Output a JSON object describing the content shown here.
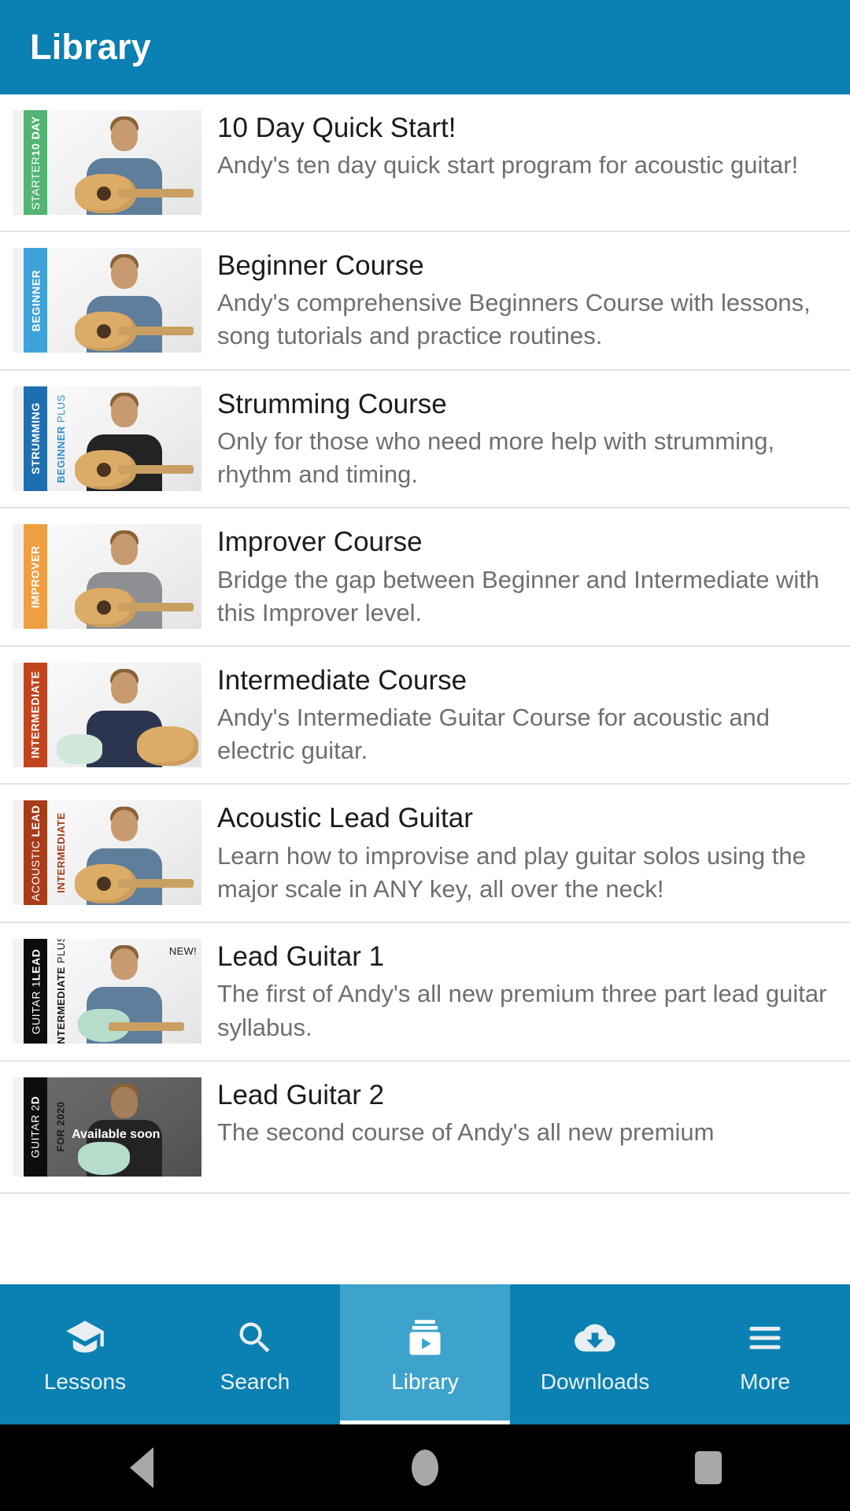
{
  "appbar": {
    "title": "Library"
  },
  "courses": [
    {
      "title": "10 Day Quick Start!",
      "description": "Andy's ten day quick start program for acoustic guitar!",
      "badge": "10 DAY STARTER",
      "badge_bold": "10 DAY",
      "badge_thin": " STARTER",
      "badge_color": "#54b473",
      "sublabel": "",
      "sublabel_color": "",
      "tag": ""
    },
    {
      "title": "Beginner Course",
      "description": "Andy's comprehensive Beginners Course with lessons, song tutorials and practice routines.",
      "badge": "BEGINNER",
      "badge_bold": "BEGINNER",
      "badge_thin": "",
      "badge_color": "#3ea3d8",
      "sublabel": "",
      "sublabel_color": "",
      "tag": ""
    },
    {
      "title": "Strumming Course",
      "description": "Only for those who need more help with strumming, rhythm and timing.",
      "badge": "STRUMMING",
      "badge_bold": "STRUMMING",
      "badge_thin": "",
      "badge_color": "#1f6fb0",
      "sublabel": "BEGINNER PLUS",
      "sublabel_bold": "BEGINNER",
      "sublabel_thin": " PLUS",
      "sublabel_color": "#2f8fd0",
      "tag": ""
    },
    {
      "title": "Improver Course",
      "description": "Bridge the gap between Beginner and Intermediate with this Improver level.",
      "badge": "IMPROVER",
      "badge_bold": "IMPROVER",
      "badge_thin": "",
      "badge_color": "#ef9f42",
      "sublabel": "",
      "sublabel_color": "",
      "tag": ""
    },
    {
      "title": "Intermediate Course",
      "description": "Andy's Intermediate Guitar Course for acoustic and electric guitar.",
      "badge": "INTERMEDIATE",
      "badge_bold": "INTERMEDIATE",
      "badge_thin": "",
      "badge_color": "#c1441f",
      "sublabel": "",
      "sublabel_color": "",
      "tag": ""
    },
    {
      "title": "Acoustic Lead Guitar",
      "description": "Learn how to improvise and play guitar solos using the major scale in ANY key, all over the neck!",
      "badge": "ACOUSTIC LEAD",
      "badge_bold": "LEAD",
      "badge_thin": "ACOUSTIC ",
      "badge_color": "#a83c18",
      "sublabel": "INTERMEDIATE",
      "sublabel_bold": "INTERMEDIATE",
      "sublabel_thin": "",
      "sublabel_color": "#a83c18",
      "tag": ""
    },
    {
      "title": "Lead Guitar 1",
      "description": "The first of Andy's all new premium three part lead guitar syllabus.",
      "badge": "LEAD GUITAR 1",
      "badge_bold": "LEAD",
      "badge_thin": " GUITAR 1",
      "badge_color": "#0d0d0d",
      "sublabel": "INTERMEDIATE PLUS",
      "sublabel_bold": "INTERMEDIATE",
      "sublabel_thin": " PLUS",
      "sublabel_color": "#1a1a1a",
      "tag": "NEW!"
    },
    {
      "title": "Lead Guitar 2",
      "description": "The second course of Andy's all new premium",
      "badge": "D GUITAR 2",
      "badge_bold": "D",
      "badge_thin": " GUITAR 2",
      "badge_color": "#0d0d0d",
      "sublabel": "FOR 2020",
      "sublabel_bold": "FOR 2020",
      "sublabel_thin": "",
      "sublabel_color": "#1a1a1a",
      "tag": "",
      "overlay": "Available soon"
    }
  ],
  "tabs": [
    {
      "label": "Lessons",
      "icon": "graduation-cap-icon",
      "active": false
    },
    {
      "label": "Search",
      "icon": "search-icon",
      "active": false
    },
    {
      "label": "Library",
      "icon": "video-library-icon",
      "active": true
    },
    {
      "label": "Downloads",
      "icon": "cloud-download-icon",
      "active": false
    },
    {
      "label": "More",
      "icon": "hamburger-menu-icon",
      "active": false
    }
  ],
  "system_nav": {
    "back": "back-button",
    "home": "home-button",
    "recents": "recents-button"
  },
  "colors": {
    "brand": "#0b80b2",
    "brand_active": "#3ea3cc",
    "title_text": "#1c1c1c",
    "body_text": "#6f6f6f",
    "divider": "#e3e3e3"
  }
}
